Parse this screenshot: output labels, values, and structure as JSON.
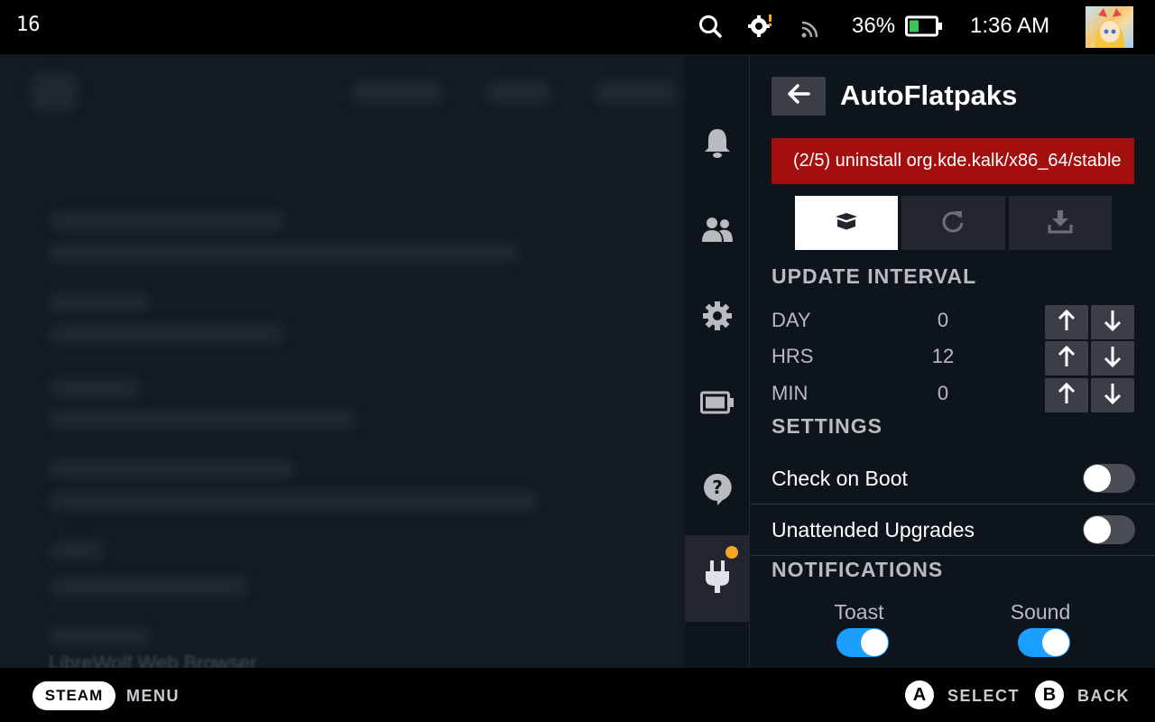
{
  "topbar": {
    "fps": "16",
    "battery_percent": "36%",
    "clock": "1:36 AM",
    "icons": [
      "search-icon",
      "settings-alert-icon",
      "cast-icon",
      "battery-icon"
    ]
  },
  "background": {
    "faded_text": "LibreWolf Web Browser"
  },
  "rail": {
    "items": [
      "bell-icon",
      "friends-icon",
      "gear-icon",
      "battery-icon",
      "help-icon",
      "plug-icon"
    ],
    "active": "plug-icon",
    "notification_dot_color": "#f5a623"
  },
  "panel": {
    "title": "AutoFlatpaks",
    "status_text": "(2/5) uninstall org.kde.kalk/x86_64/stable",
    "status_color": "#a30f0f",
    "tabs": [
      "box-icon",
      "refresh-icon",
      "download-icon"
    ],
    "active_tab": "box-icon"
  },
  "update_interval": {
    "title": "UPDATE INTERVAL",
    "rows": [
      {
        "label": "DAY",
        "value": "0"
      },
      {
        "label": "HRS",
        "value": "12"
      },
      {
        "label": "MIN",
        "value": "0"
      }
    ]
  },
  "settings": {
    "title": "SETTINGS",
    "items": [
      {
        "label": "Check on Boot",
        "enabled": false
      },
      {
        "label": "Unattended Upgrades",
        "enabled": false
      }
    ]
  },
  "notifications": {
    "title": "NOTIFICATIONS",
    "toast_label": "Toast",
    "toast_enabled": true,
    "sound_label": "Sound",
    "sound_enabled": true,
    "accent": "#1a9fff"
  },
  "bottombar": {
    "steam_label": "STEAM",
    "menu_label": "MENU",
    "a_button": "A",
    "select_label": "SELECT",
    "b_button": "B",
    "back_label": "BACK"
  }
}
